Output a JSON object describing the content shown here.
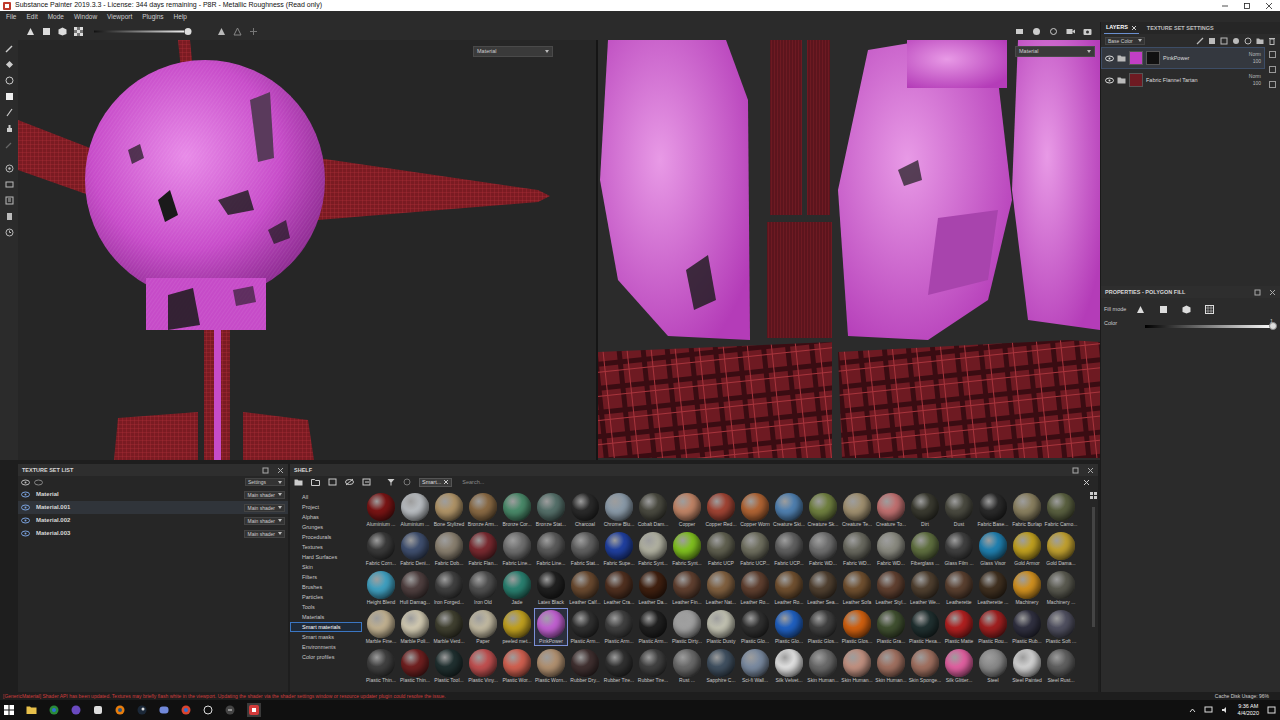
{
  "window": {
    "title": "Substance Painter 2019.3.3 - License: 344 days remaining - P8R - Metallic Roughness (Read only)"
  },
  "menu": [
    "File",
    "Edit",
    "Mode",
    "Window",
    "Viewport",
    "Plugins",
    "Help"
  ],
  "viewport_3d": {
    "dropdown": "Material"
  },
  "viewport_2d": {
    "dropdown": "Material"
  },
  "layers": {
    "tabs": [
      {
        "label": "LAYERS",
        "selected": true
      },
      {
        "label": "TEXTURE SET SETTINGS",
        "selected": false
      }
    ],
    "channel": "Base Color",
    "items": [
      {
        "name": "PinkPower",
        "blend": "Norm",
        "opacity": "100",
        "selected": true,
        "visible": true,
        "color": "#c23fc6"
      },
      {
        "name": "Fabric Flannel Tartan",
        "blend": "Norm",
        "opacity": "100",
        "selected": false,
        "visible": true,
        "color": "#6e1a22"
      }
    ]
  },
  "properties": {
    "title": "PROPERTIES - POLYGON FILL",
    "fill_mode_label": "Fill mode",
    "color_label": "Color",
    "color_value": "1",
    "level": 1
  },
  "texture_sets": {
    "title": "TEXTURE SET LIST",
    "settings": "Settings",
    "items": [
      {
        "name": "Material",
        "shader": "Main shader",
        "selected": false,
        "visible": true
      },
      {
        "name": "Material.001",
        "shader": "Main shader",
        "selected": true,
        "visible": true
      },
      {
        "name": "Material.002",
        "shader": "Main shader",
        "selected": false,
        "visible": true
      },
      {
        "name": "Material.003",
        "shader": "Main shader",
        "selected": false,
        "visible": true
      }
    ]
  },
  "shelf": {
    "title": "SHELF",
    "filter": "Smart...",
    "search": {
      "placeholder": "Search..."
    },
    "categories": [
      {
        "label": "All",
        "selected": false
      },
      {
        "label": "Project",
        "selected": false
      },
      {
        "label": "Alphas",
        "selected": false
      },
      {
        "label": "Grunges",
        "selected": false
      },
      {
        "label": "Procedurals",
        "selected": false
      },
      {
        "label": "Textures",
        "selected": false
      },
      {
        "label": "Hard Surfaces",
        "selected": false
      },
      {
        "label": "Skin",
        "selected": false
      },
      {
        "label": "Filters",
        "selected": false
      },
      {
        "label": "Brushes",
        "selected": false
      },
      {
        "label": "Particles",
        "selected": false
      },
      {
        "label": "Tools",
        "selected": false
      },
      {
        "label": "Materials",
        "selected": false
      },
      {
        "label": "Smart materials",
        "selected": true
      },
      {
        "label": "Smart masks",
        "selected": false
      },
      {
        "label": "Environments",
        "selected": false
      },
      {
        "label": "Color profiles",
        "selected": false
      }
    ],
    "items": [
      {
        "label": "Aluminium ...",
        "color": "#7a1414",
        "selected": false
      },
      {
        "label": "Aluminium ...",
        "color": "#b8bcc0",
        "selected": false
      },
      {
        "label": "Bone Stylized",
        "color": "#b09468",
        "selected": false
      },
      {
        "label": "Bronze Arm...",
        "color": "#8a6a44",
        "selected": false
      },
      {
        "label": "Bronze Cor...",
        "color": "#4a8a6a",
        "selected": false
      },
      {
        "label": "Bronze Stat...",
        "color": "#55706a",
        "selected": false
      },
      {
        "label": "Charcoal",
        "color": "#2a2a2a",
        "selected": false
      },
      {
        "label": "Chrome Blu...",
        "color": "#8a9aa8",
        "selected": false
      },
      {
        "label": "Cobalt Dam...",
        "color": "#4a4a40",
        "selected": false
      },
      {
        "label": "Copper",
        "color": "#c08466",
        "selected": false
      },
      {
        "label": "Copper Red...",
        "color": "#a04434",
        "selected": false
      },
      {
        "label": "Copper Worn",
        "color": "#b06434",
        "selected": false
      },
      {
        "label": "Creature Ski...",
        "color": "#5080b0",
        "selected": false
      },
      {
        "label": "Creature Sk...",
        "color": "#708040",
        "selected": false
      },
      {
        "label": "Creature Te...",
        "color": "#a09070",
        "selected": false
      },
      {
        "label": "Creature To...",
        "color": "#c07070",
        "selected": false
      },
      {
        "label": "Dirt",
        "color": "#3a3a30",
        "selected": false
      },
      {
        "label": "Dust",
        "color": "#4a4a40",
        "selected": false
      },
      {
        "label": "Fabric Base...",
        "color": "#2a2a2a",
        "selected": false
      },
      {
        "label": "Fabric Burlap",
        "color": "#8a8060",
        "selected": false
      },
      {
        "label": "Fabric Camo...",
        "color": "#5a6040",
        "selected": false
      },
      {
        "label": "Fabric Corn...",
        "color": "#3a3a3a",
        "selected": false
      },
      {
        "label": "Fabric Deni...",
        "color": "#405070",
        "selected": false
      },
      {
        "label": "Fabric Dob...",
        "color": "#8a8070",
        "selected": false
      },
      {
        "label": "Fabric Flan...",
        "color": "#7a2a30",
        "selected": false
      },
      {
        "label": "Fabric Line...",
        "color": "#707070",
        "selected": false
      },
      {
        "label": "Fabric Line...",
        "color": "#5a5a5a",
        "selected": false
      },
      {
        "label": "Fabric Stat...",
        "color": "#606060",
        "selected": false
      },
      {
        "label": "Fabric Supe...",
        "color": "#2040a0",
        "selected": false
      },
      {
        "label": "Fabric Synt...",
        "color": "#b0b0a0",
        "selected": false
      },
      {
        "label": "Fabric Synt...",
        "color": "#80c020",
        "selected": false
      },
      {
        "label": "Fabric UCP",
        "color": "#606050",
        "selected": false
      },
      {
        "label": "Fabric UCP...",
        "color": "#707060",
        "selected": false
      },
      {
        "label": "Fabric UCP...",
        "color": "#606060",
        "selected": false
      },
      {
        "label": "Fabric WD...",
        "color": "#707070",
        "selected": false
      },
      {
        "label": "Fabric WD...",
        "color": "#6a6a60",
        "selected": false
      },
      {
        "label": "Fabric WD...",
        "color": "#8a8a80",
        "selected": false
      },
      {
        "label": "Fiberglass ...",
        "color": "#607040",
        "selected": false
      },
      {
        "label": "Glass Film ...",
        "color": "#404040",
        "selected": false
      },
      {
        "label": "Glass Visor",
        "color": "#2080b0",
        "selected": false
      },
      {
        "label": "Gold Armor",
        "color": "#c0a020",
        "selected": false
      },
      {
        "label": "Gold Dama...",
        "color": "#c0a030",
        "selected": false
      },
      {
        "label": "Height Blend",
        "color": "#40a0c0",
        "selected": false
      },
      {
        "label": "Hull Damag...",
        "color": "#504040",
        "selected": false
      },
      {
        "label": "Iron Forged...",
        "color": "#404040",
        "selected": false
      },
      {
        "label": "Iron Old",
        "color": "#505050",
        "selected": false
      },
      {
        "label": "Jade",
        "color": "#2a8070",
        "selected": false
      },
      {
        "label": "Latex Black",
        "color": "#202020",
        "selected": false
      },
      {
        "label": "Leather Calf...",
        "color": "#6a4a30",
        "selected": false
      },
      {
        "label": "Leather Cra...",
        "color": "#503020",
        "selected": false
      },
      {
        "label": "Leather Da...",
        "color": "#402010",
        "selected": false
      },
      {
        "label": "Leather Fin...",
        "color": "#604030",
        "selected": false
      },
      {
        "label": "Leather Nat...",
        "color": "#806040",
        "selected": false
      },
      {
        "label": "Leather Ro...",
        "color": "#604030",
        "selected": false
      },
      {
        "label": "Leather Ro...",
        "color": "#705030",
        "selected": false
      },
      {
        "label": "Leather Sea...",
        "color": "#504030",
        "selected": false
      },
      {
        "label": "Leather Sofa",
        "color": "#705030",
        "selected": false
      },
      {
        "label": "Leather Styl...",
        "color": "#604030",
        "selected": false
      },
      {
        "label": "Leather We...",
        "color": "#504030",
        "selected": false
      },
      {
        "label": "Leatherette",
        "color": "#5a4030",
        "selected": false
      },
      {
        "label": "Leatherette ...",
        "color": "#403020",
        "selected": false
      },
      {
        "label": "Machinery",
        "color": "#d09020",
        "selected": false
      },
      {
        "label": "Machinery ...",
        "color": "#5a5a50",
        "selected": false
      },
      {
        "label": "Marble Fine...",
        "color": "#c0b090",
        "selected": false
      },
      {
        "label": "Marble Poli...",
        "color": "#d0c8b0",
        "selected": false
      },
      {
        "label": "Marble Verd...",
        "color": "#404030",
        "selected": false
      },
      {
        "label": "Paper",
        "color": "#c0b8a0",
        "selected": false
      },
      {
        "label": "peeled met...",
        "color": "#c0a020",
        "selected": false
      },
      {
        "label": "PinkPower",
        "color": "#c060d0",
        "selected": true
      },
      {
        "label": "Plastic Arm...",
        "color": "#303030",
        "selected": false
      },
      {
        "label": "Plastic Arm...",
        "color": "#404040",
        "selected": false
      },
      {
        "label": "Plastic Arm...",
        "color": "#202020",
        "selected": false
      },
      {
        "label": "Plastic Dirty...",
        "color": "#a0a0a0",
        "selected": false
      },
      {
        "label": "Plastic Dusty",
        "color": "#c0c0b0",
        "selected": false
      },
      {
        "label": "Plastic Glo...",
        "color": "#303030",
        "selected": false
      },
      {
        "label": "Plastic Glo...",
        "color": "#2060c0",
        "selected": false
      },
      {
        "label": "Plastic Glos...",
        "color": "#404040",
        "selected": false
      },
      {
        "label": "Plastic Glos...",
        "color": "#d06010",
        "selected": false
      },
      {
        "label": "Plastic Gra...",
        "color": "#405030",
        "selected": false
      },
      {
        "label": "Plastic Hexa...",
        "color": "#203030",
        "selected": false
      },
      {
        "label": "Plastic Matte",
        "color": "#b02020",
        "selected": false
      },
      {
        "label": "Plastic Rou...",
        "color": "#a02020",
        "selected": false
      },
      {
        "label": "Plastic Rub...",
        "color": "#303040",
        "selected": false
      },
      {
        "label": "Plastic Soft ...",
        "color": "#505060",
        "selected": false
      },
      {
        "label": "Plastic Thin...",
        "color": "#404040",
        "selected": false
      },
      {
        "label": "Plastic Thin...",
        "color": "#702020",
        "selected": false
      },
      {
        "label": "Plastic Tool...",
        "color": "#203030",
        "selected": false
      },
      {
        "label": "Plastic Viny...",
        "color": "#c05050",
        "selected": false
      },
      {
        "label": "Plastic Wor...",
        "color": "#d06050",
        "selected": false
      },
      {
        "label": "Plastic Worn...",
        "color": "#b09070",
        "selected": false
      },
      {
        "label": "Rubber Dry...",
        "color": "#403030",
        "selected": false
      },
      {
        "label": "Rubber Tire...",
        "color": "#303030",
        "selected": false
      },
      {
        "label": "Rubber Tire...",
        "color": "#404040",
        "selected": false
      },
      {
        "label": "Rust ...",
        "color": "#6a6a6a",
        "selected": false
      },
      {
        "label": "Sapphire C...",
        "color": "#405060",
        "selected": false
      },
      {
        "label": "Sci-fi Wall...",
        "color": "#7a8aa0",
        "selected": false
      },
      {
        "label": "Silk Velvet...",
        "color": "#e0e0e0",
        "selected": false
      },
      {
        "label": "Skin Human...",
        "color": "#6a6a6a",
        "selected": false
      },
      {
        "label": "Skin Human...",
        "color": "#c09080",
        "selected": false
      },
      {
        "label": "Skin Human...",
        "color": "#a07060",
        "selected": false
      },
      {
        "label": "Skin Sponge...",
        "color": "#a07060",
        "selected": false
      },
      {
        "label": "Silk Glitter...",
        "color": "#e060a0",
        "selected": false
      },
      {
        "label": "Steel",
        "color": "#8a8a8a",
        "selected": false
      },
      {
        "label": "Steel Painted",
        "color": "#d0d0d0",
        "selected": false
      },
      {
        "label": "Steel Rust...",
        "color": "#606060",
        "selected": false
      }
    ]
  },
  "status": {
    "message": "[GenericMaterial] Shader API has been updated. Textures may briefly flash white in the viewport. Updating the shader via the shader settings window or resource updater plugin could resolve the issue.",
    "cache": "Cache Disk Usage: 96%"
  },
  "taskbar": {
    "time": "9:36 AM",
    "date": "4/4/2020"
  }
}
